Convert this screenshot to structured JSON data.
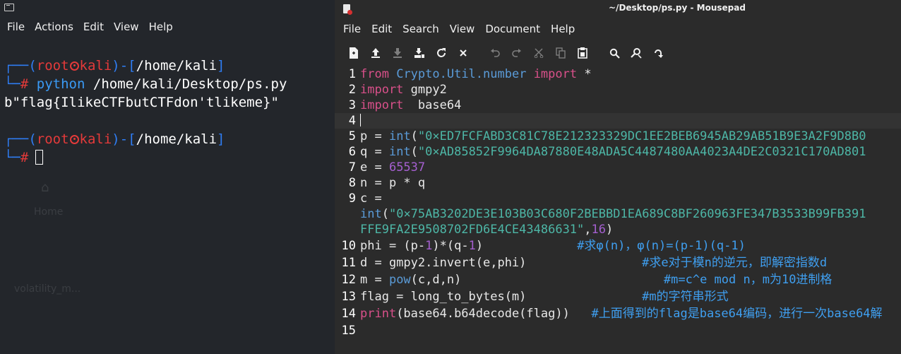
{
  "terminal": {
    "menu": [
      "File",
      "Actions",
      "Edit",
      "View",
      "Help"
    ],
    "prompt1": {
      "user": "root",
      "host": "kali",
      "path": "/home/kali"
    },
    "command": {
      "name": "python",
      "arg": "/home/kali/Desktop/ps.py"
    },
    "output": "b\"flag{IlikeCTFbutCTFdon'tlikeme}\"",
    "prompt2": {
      "user": "root",
      "host": "kali",
      "path": "/home/kali"
    },
    "background": {
      "home_label": "Home",
      "file_label": "volatility_m..."
    }
  },
  "editor": {
    "title": "~/Desktop/ps.py - Mousepad",
    "menu": [
      "File",
      "Edit",
      "Search",
      "View",
      "Document",
      "Help"
    ],
    "toolbar_icons": [
      "new-document-icon",
      "open-icon",
      "save-icon",
      "save-as-icon",
      "reload-icon",
      "close-icon",
      "undo-icon",
      "redo-icon",
      "cut-icon",
      "copy-icon",
      "paste-icon",
      "find-icon",
      "find-replace-icon",
      "go-to-line-icon"
    ],
    "line_numbers": [
      "1",
      "2",
      "3",
      "4",
      "5",
      "6",
      "7",
      "8",
      "9",
      "10",
      "11",
      "12",
      "13",
      "14",
      "15"
    ],
    "code": {
      "l1_from": "from",
      "l1_module": "Crypto.Util.number",
      "l1_import": "import",
      "l1_rest": " *",
      "l2_import": "import",
      "l2_rest": " gmpy2",
      "l3_import": "import",
      "l3_rest": "  base64",
      "l5_prefix": "p = ",
      "l5_fn": "int",
      "l5_paren": "(",
      "l5_str": "\"0×ED7FCFABD3C81C78E212323329DC1EE2BEB6945AB29AB51B9E3A2F9D8B0",
      "l6_prefix": "q = ",
      "l6_fn": "int",
      "l6_paren": "(",
      "l6_str": "\"0×AD85852F9964DA87880E48ADA5C4487480AA4023A4DE2C0321C170AD801",
      "l7_prefix": "e = ",
      "l7_num": "65537",
      "l8": "n = p * q",
      "l9": "c =",
      "l9b_fn": "int",
      "l9b_paren": "(",
      "l9b_str": "\"0×75AB3202DE3E103B03C680F2BEBBD1EA689C8BF260963FE347B3533B99FB391",
      "l9c_str": "FFE9FA2E9508702FD6E4CE43486631\"",
      "l9c_comma": ",",
      "l9c_num": "16",
      "l9c_close": ")",
      "l10_a": "phi = (p-",
      "l10_n1": "1",
      "l10_b": ")*(q-",
      "l10_n2": "1",
      "l10_c": ")",
      "l10_pad": "             ",
      "l10_comment": "#求φ(n)，φ(n)=(p-1)(q-1)",
      "l11_code": "d = gmpy2.invert(e,phi)",
      "l11_pad": "                ",
      "l11_comment": "#求e对于模n的逆元，即解密指数d",
      "l12_a": "m = ",
      "l12_fn": "pow",
      "l12_b": "(c,d,n)",
      "l12_pad": "                            ",
      "l12_comment": "#m=c^e mod n，m为10进制格",
      "l13_code": "flag = long_to_bytes(m)",
      "l13_pad": "                ",
      "l13_comment": "#m的字符串形式",
      "l14_fn": "print",
      "l14_b": "(base64.b64decode(flag))",
      "l14_pad": "   ",
      "l14_comment": "#上面得到的flag是base64编码，进行一次base64解"
    }
  }
}
